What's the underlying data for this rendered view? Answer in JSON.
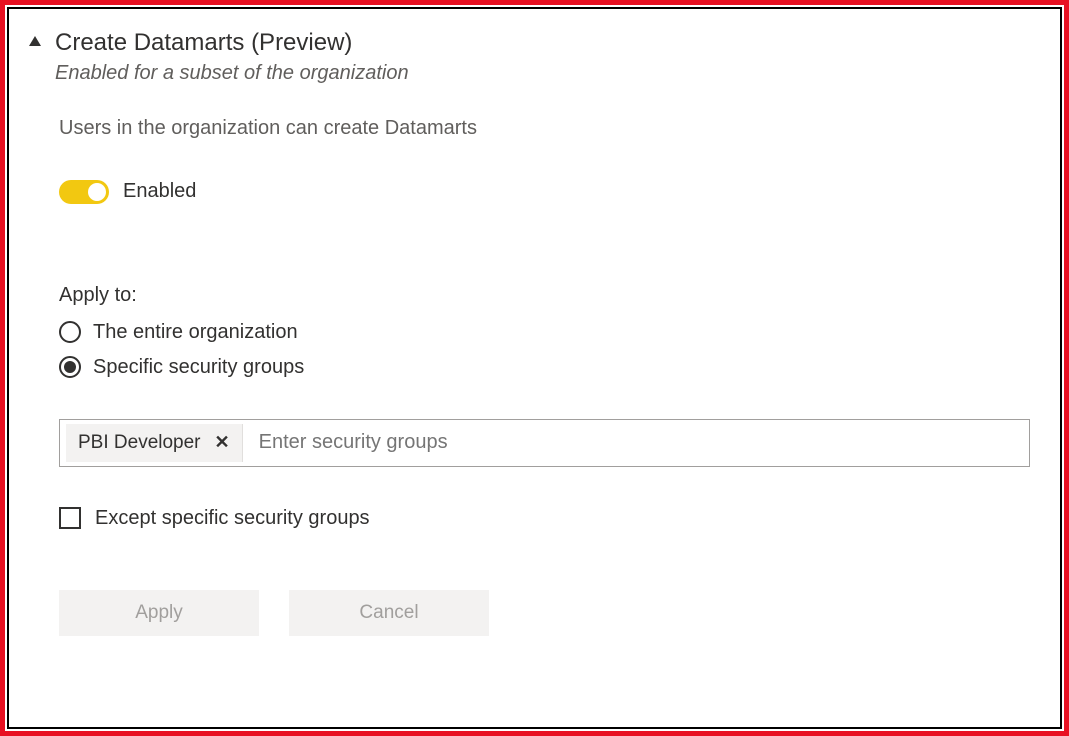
{
  "setting": {
    "title": "Create Datamarts (Preview)",
    "subtitle": "Enabled for a subset of the organization",
    "description": "Users in the organization can create Datamarts",
    "toggle": {
      "state": "on",
      "label": "Enabled"
    },
    "applyTo": {
      "label": "Apply to:",
      "options": [
        {
          "label": "The entire organization",
          "selected": false
        },
        {
          "label": "Specific security groups",
          "selected": true
        }
      ],
      "securityGroups": {
        "chips": [
          {
            "name": "PBI Developer"
          }
        ],
        "placeholder": "Enter security groups"
      },
      "excludeCheckbox": {
        "label": "Except specific security groups",
        "checked": false
      }
    },
    "buttons": {
      "apply": "Apply",
      "cancel": "Cancel"
    }
  }
}
